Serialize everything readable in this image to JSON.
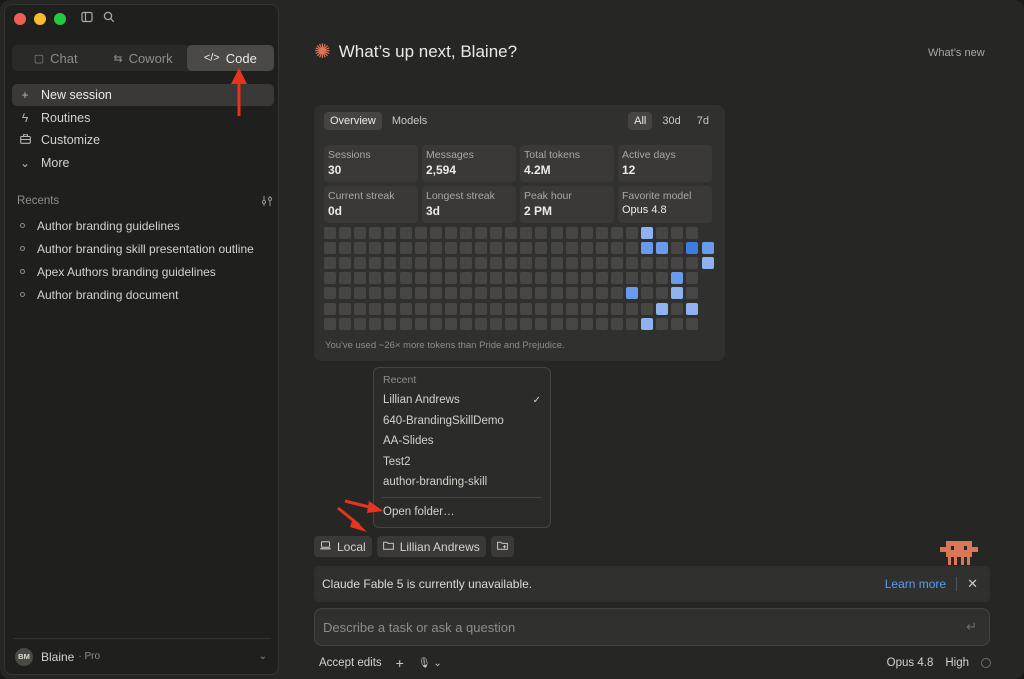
{
  "sidebar": {
    "tabs": [
      {
        "label": "Chat",
        "icon": "chat-icon"
      },
      {
        "label": "Cowork",
        "icon": "cowork-icon"
      },
      {
        "label": "Code",
        "icon": "code-icon",
        "active": true
      }
    ],
    "nav": [
      {
        "label": "New session",
        "icon": "plus-icon",
        "active": true
      },
      {
        "label": "Routines",
        "icon": "bolt-icon"
      },
      {
        "label": "Customize",
        "icon": "briefcase-icon"
      },
      {
        "label": "More",
        "icon": "chevron-down-icon"
      }
    ],
    "recents_label": "Recents",
    "recents": [
      "Author branding guidelines",
      "Author branding skill presentation outline",
      "Apex Authors branding guidelines",
      "Author branding document"
    ],
    "user": {
      "initials": "BM",
      "name": "Blaine",
      "plan": "· Pro"
    }
  },
  "main": {
    "greeting": "What’s up next, Blaine?",
    "whats_new": "What’s new"
  },
  "stats": {
    "tabs": [
      "Overview",
      "Models"
    ],
    "ranges": [
      "All",
      "30d",
      "7d"
    ],
    "cards": [
      {
        "label": "Sessions",
        "value": "30"
      },
      {
        "label": "Messages",
        "value": "2,594"
      },
      {
        "label": "Total tokens",
        "value": "4.2M"
      },
      {
        "label": "Active days",
        "value": "12"
      },
      {
        "label": "Current streak",
        "value": "0d"
      },
      {
        "label": "Longest streak",
        "value": "3d"
      },
      {
        "label": "Peak hour",
        "value": "2 PM"
      },
      {
        "label": "Favorite model",
        "value": "Opus 4.8"
      }
    ],
    "footnote": "You've used ~26× more tokens than Pride and Prejudice.",
    "heat_colors": {
      "empty": "#474643",
      "low": "#8fb3f0",
      "mid": "#6a9bea",
      "high": "#3f7de0"
    }
  },
  "dropdown": {
    "header": "Recent",
    "items": [
      "Lillian Andrews",
      "640-BrandingSkillDemo",
      "AA-Slides",
      "Test2",
      "author-branding-skill"
    ],
    "selected": "Lillian Andrews",
    "open_folder": "Open folder…"
  },
  "chips": {
    "local": "Local",
    "folder": "Lillian Andrews"
  },
  "banner": {
    "text": "Claude Fable 5 is currently unavailable.",
    "link": "Learn more"
  },
  "composer": {
    "placeholder": "Describe a task or ask a question",
    "accept_edits": "Accept edits",
    "model": "Opus 4.8",
    "effort": "High"
  },
  "colors": {
    "accent": "#d97757",
    "link": "#5b9cf2",
    "annotation_arrow": "#e8341c"
  }
}
